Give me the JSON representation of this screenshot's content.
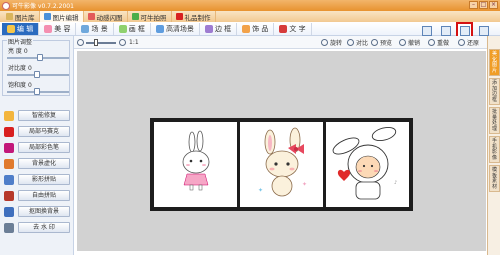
{
  "app": {
    "title": "可牛影像 v0.7.2.2001"
  },
  "window_controls": [
    "–",
    "□",
    "×"
  ],
  "top_tabs": [
    {
      "label": "图片库",
      "color": "#d9b45c"
    },
    {
      "label": "图片编辑",
      "color": "#4a90d9"
    },
    {
      "label": "动感闪图",
      "color": "#e35a5a"
    },
    {
      "label": "可牛拍照",
      "color": "#4aae4a"
    },
    {
      "label": "礼品制作",
      "color": "#d82020"
    }
  ],
  "functions": [
    {
      "label": "编 辑",
      "active": true,
      "color": "#f6c64a"
    },
    {
      "label": "美 容",
      "active": false,
      "color": "#f48fb1"
    },
    {
      "label": "场 景",
      "active": false,
      "color": "#6fa8dc"
    },
    {
      "label": "画 框",
      "active": false,
      "color": "#8fd16f"
    },
    {
      "label": "高清场景",
      "active": false,
      "color": "#5f9ddf"
    },
    {
      "label": "边 框",
      "active": false,
      "color": "#9e7cd1"
    },
    {
      "label": "饰 品",
      "active": false,
      "color": "#f2a24a"
    },
    {
      "label": "文 字",
      "active": false,
      "color": "#d63b3b"
    }
  ],
  "right_tools": [
    {
      "label": "新建",
      "active": false
    },
    {
      "label": "打开",
      "active": false
    },
    {
      "label": "保存",
      "active": true
    },
    {
      "label": "视图",
      "active": false
    }
  ],
  "sidebar": {
    "group_title": "图片调整",
    "sliders": [
      {
        "label": "亮 度",
        "value": "0",
        "level": 0.55
      },
      {
        "label": "对比度",
        "value": "0",
        "level": 0.5
      },
      {
        "label": "饱和度",
        "value": "0",
        "level": 0.5
      }
    ],
    "buttons": [
      {
        "label": "智能修复",
        "color": "#f3b53d"
      },
      {
        "label": "局部马赛克",
        "color": "#d82020"
      },
      {
        "label": "局部彩色笔",
        "color": "#c2187a"
      },
      {
        "label": "背景虚化",
        "color": "#e07a2e"
      },
      {
        "label": "影形拼贴",
        "color": "#4f7ec9"
      },
      {
        "label": "自由拼贴",
        "color": "#b6382a"
      },
      {
        "label": "抠图换背景",
        "color": "#3f6fbd"
      },
      {
        "label": "去 水 印",
        "color": "#6b7e96"
      }
    ]
  },
  "zoombar": {
    "fit_label": "1:1",
    "actions": [
      "旋转",
      "对比",
      "预览",
      "撤销",
      "重做",
      "还原"
    ]
  },
  "photos": [
    {
      "name": "bunny-pink-dress"
    },
    {
      "name": "bunny-bow"
    },
    {
      "name": "bunny-costume-heart"
    }
  ],
  "right_tabs": [
    "美化图片",
    "添加边框",
    "批量处理",
    "手机影像",
    "模板素材"
  ]
}
